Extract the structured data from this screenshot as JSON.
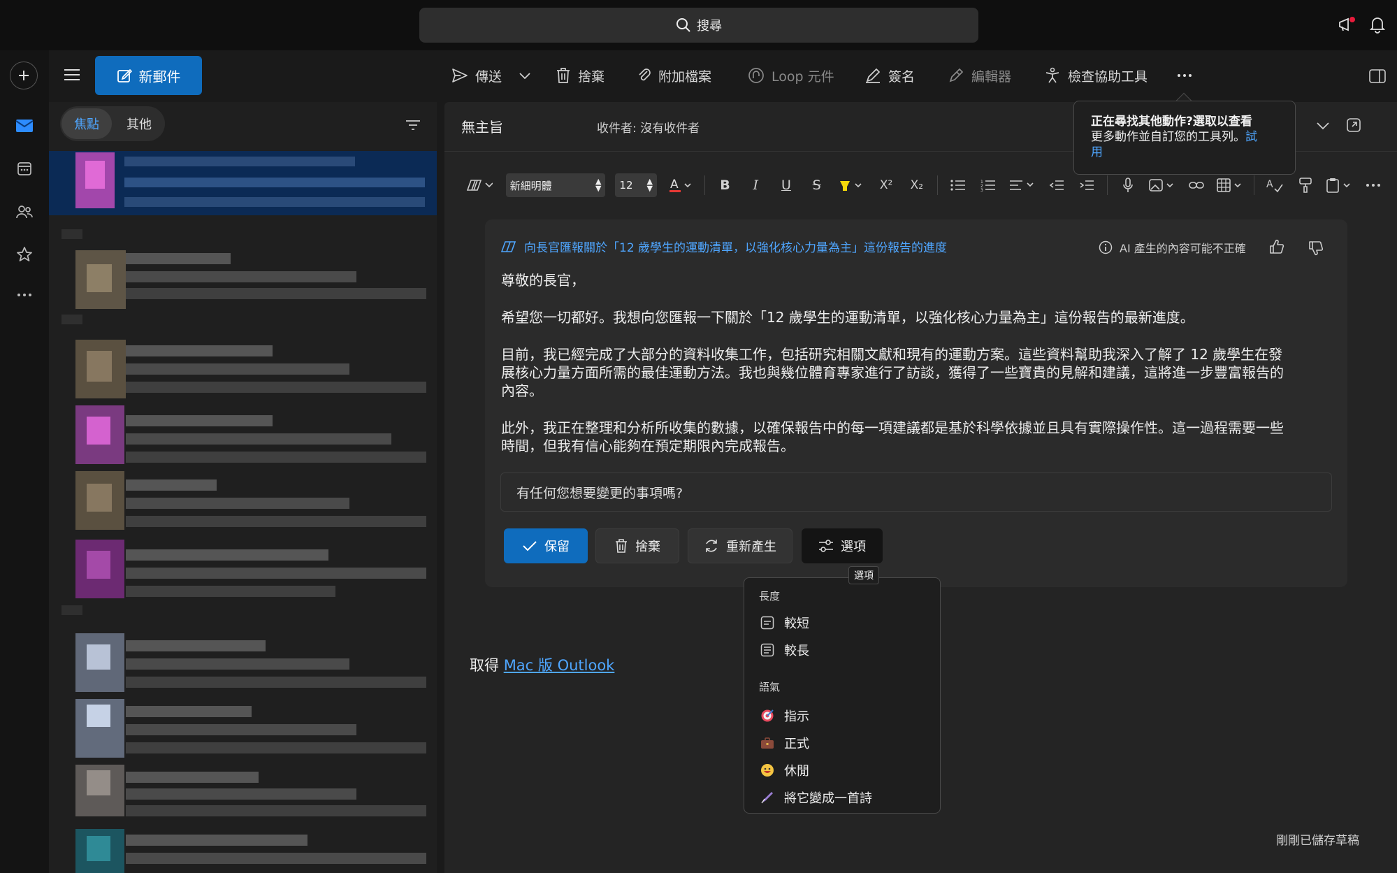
{
  "top": {
    "search_label": "搜尋"
  },
  "toolbar": {
    "new_mail": "新郵件",
    "send": "傳送",
    "discard": "捨棄",
    "attach": "附加檔案",
    "loop": "Loop 元件",
    "signature": "簽名",
    "editor": "編輯器",
    "accessibility": "檢查協助工具"
  },
  "mail_list": {
    "tab_focused": "焦點",
    "tab_other": "其他"
  },
  "compose": {
    "subject": "無主旨",
    "recipients": "收件者: 沒有收件者",
    "font_name": "新細明體",
    "font_size": "12",
    "footer_prefix": "取得",
    "footer_link": "Mac 版 Outlook",
    "draft_status": "剛剛已儲存草稿"
  },
  "copilot": {
    "prompt_title": "向長官匯報關於「12 歲學生的運動清單，以強化核心力量為主」這份報告的進度",
    "disclaimer": "AI 產生的內容可能不正確",
    "greeting": "尊敬的長官，",
    "para1": "希望您一切都好。我想向您匯報一下關於「12 歲學生的運動清單，以強化核心力量為主」這份報告的最新進度。",
    "para2_line1": "目前，我已經完成了大部分的資料收集工作，包括研究相關文獻和現有的運動方案。這些資料幫助我深入了解了 12 歲學生在發",
    "para2_line2": "展核心力量方面所需的最佳運動方法。我也與幾位體育專家進行了訪談，獲得了一些寶貴的見解和建議，這將進一步豐富報告的",
    "para2_line3": "內容。",
    "para3_line1": "此外，我正在整理和分析所收集的數據，以確保報告中的每一項建議都是基於科學依據並且具有實際操作性。這一過程需要一些",
    "para3_line2": "時間，但我有信心能夠在預定期限內完成報告。",
    "change_prompt": "有任何您想要變更的事項嗎?",
    "keep": "保留",
    "discard": "捨棄",
    "regenerate": "重新產生",
    "options": "選項",
    "options_tooltip": "選項"
  },
  "tooltip": {
    "line1": "正在尋找其他動作?選取以查看",
    "line2_text": "更多動作並自訂您的工具列。",
    "line2_link": "試",
    "line3_link": "用"
  },
  "options_menu": {
    "length_header": "長度",
    "shorter": "較短",
    "longer": "較長",
    "tone_header": "語氣",
    "direct": "指示",
    "formal": "正式",
    "casual": "休閒",
    "poem": "將它變成一首詩"
  },
  "colors": {
    "accent": "#0f6cbd",
    "link": "#4fa6ff",
    "background": "#1a1a1a"
  }
}
